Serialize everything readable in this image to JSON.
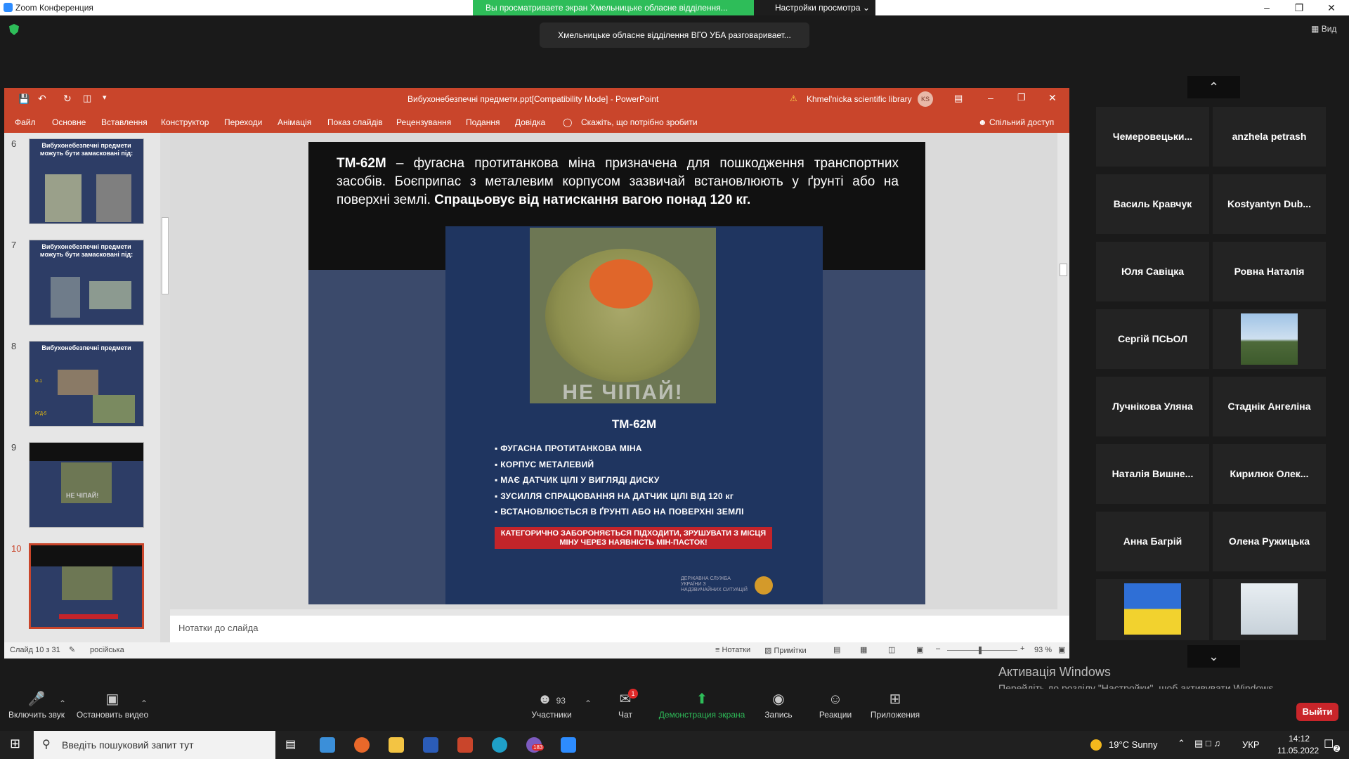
{
  "zoom": {
    "title": "Zoom Конференция",
    "share_banner": "Вы просматриваете экран Хмельницьке обласне відділення...",
    "view_options": "Настройки просмотра",
    "speaker": "Хмельницьке обласне відділення ВГО УБА разговаривает...",
    "view_btn": "Вид",
    "icons": {
      "minimize": "minimize-icon",
      "restore": "restore-icon",
      "close": "close-icon",
      "shield": "shield-icon"
    }
  },
  "ppt": {
    "title": "Вибухонебезпечні предмети.ppt[Compatibility Mode]  -  PowerPoint",
    "account": "Khmel'nicka scientific library",
    "account_initials": "KS",
    "ribbon_tabs": [
      "Файл",
      "Основне",
      "Вставлення",
      "Конструктор",
      "Переходи",
      "Анімація",
      "Показ слайдів",
      "Рецензування",
      "Подання",
      "Довідка"
    ],
    "tell_me": "Скажіть, що потрібно зробити",
    "share": "Спільний доступ",
    "thumbnails": [
      {
        "num": "6",
        "title": "Вибухонебезпечні предмети можуть бути замасковані під:"
      },
      {
        "num": "7",
        "title": "Вибухонебезпечні предмети можуть бути замасковані під:"
      },
      {
        "num": "8",
        "title": "Вибухонебезпечні предмети"
      },
      {
        "num": "9",
        "title": ""
      },
      {
        "num": "10",
        "title": ""
      }
    ],
    "thumb8_labels": [
      "Ф-1",
      "РГД-5"
    ],
    "thumb9_stamp": "НЕ ЧІПАЙ!",
    "slide": {
      "text_bold_1": "ТМ-62М",
      "text_1": " – фугасна протитанкова міна призначена для пошкодження транспортних засобів. Боєприпас з металевим корпусом зазвичай встановлюють у ґрунті або на поверхні землі. ",
      "text_bold_2": "Спрацьовує від натискання вагою понад 120 кг.",
      "stamp": "НЕ ЧІПАЙ!",
      "subtitle": "ТМ-62М",
      "bullets": [
        "ФУГАСНА ПРОТИТАНКОВА МІНА",
        "КОРПУС МЕТАЛЕВИЙ",
        "МАЄ ДАТЧИК ЦІЛІ У ВИГЛЯДІ ДИСКУ",
        "ЗУСИЛЛЯ СПРАЦЮВАННЯ НА ДАТЧИК ЦІЛІ ВІД 120 кг",
        "ВСТАНОВЛЮЄТЬСЯ В ҐРУНТІ АБО НА ПОВЕРХНІ ЗЕМЛІ"
      ],
      "warning": "КАТЕГОРИЧНО ЗАБОРОНЯЄТЬСЯ ПІДХОДИТИ, ЗРУШУВАТИ З МІСЦЯ МІНУ ЧЕРЕЗ НАЯВНІСТЬ МІН-ПАСТОК!",
      "dsns": "ДЕРЖАВНА СЛУЖБА УКРАЇНИ З НАДЗВИЧАЙНИХ СИТУАЦІЙ"
    },
    "notes_placeholder": "Нотатки до слайда",
    "status": {
      "slide": "Слайд 10 з 31",
      "language": "російська",
      "notes": "Нотатки",
      "comments": "Примітки",
      "zoom": "93 %"
    },
    "zoom_slider_percent": 45
  },
  "gallery": {
    "tiles": [
      "Чемеровецьки...",
      "anzhela petrash",
      "Василь Кравчук",
      "Kostyantyn Dub...",
      "Юля Савіцка",
      "Ровна Наталія",
      "Сергій ПСЬОЛ",
      "",
      "Лучнікова Уляна",
      "Стаднік Ангеліна",
      "Наталія Вишне...",
      "Кирилюк Олек...",
      "Анна Багрій",
      "Олена Ружицька",
      "",
      ""
    ]
  },
  "activation": {
    "title": "Активація Windows",
    "subtitle": "Перейдіть до розділу \"Настройки\", щоб активувати Windows."
  },
  "toolbar": {
    "unmute": "Включить звук",
    "video": "Остановить видео",
    "participants": "Участники",
    "participants_count": "93",
    "chat": "Чат",
    "chat_badge": "1",
    "share": "Демонстрация экрана",
    "record": "Запись",
    "reactions": "Реакции",
    "apps": "Приложения",
    "leave": "Выйти"
  },
  "taskbar": {
    "search_placeholder": "Введіть пошуковий запит тут",
    "weather": "19°C  Sunny",
    "lang": "УКР",
    "time": "14:12",
    "date": "11.05.2022",
    "viber_badge": "183",
    "notif_badge": "2"
  },
  "colors": {
    "ppt_red": "#c9452b",
    "zoom_green": "#2ebd59",
    "leave_red": "#c9252a"
  }
}
